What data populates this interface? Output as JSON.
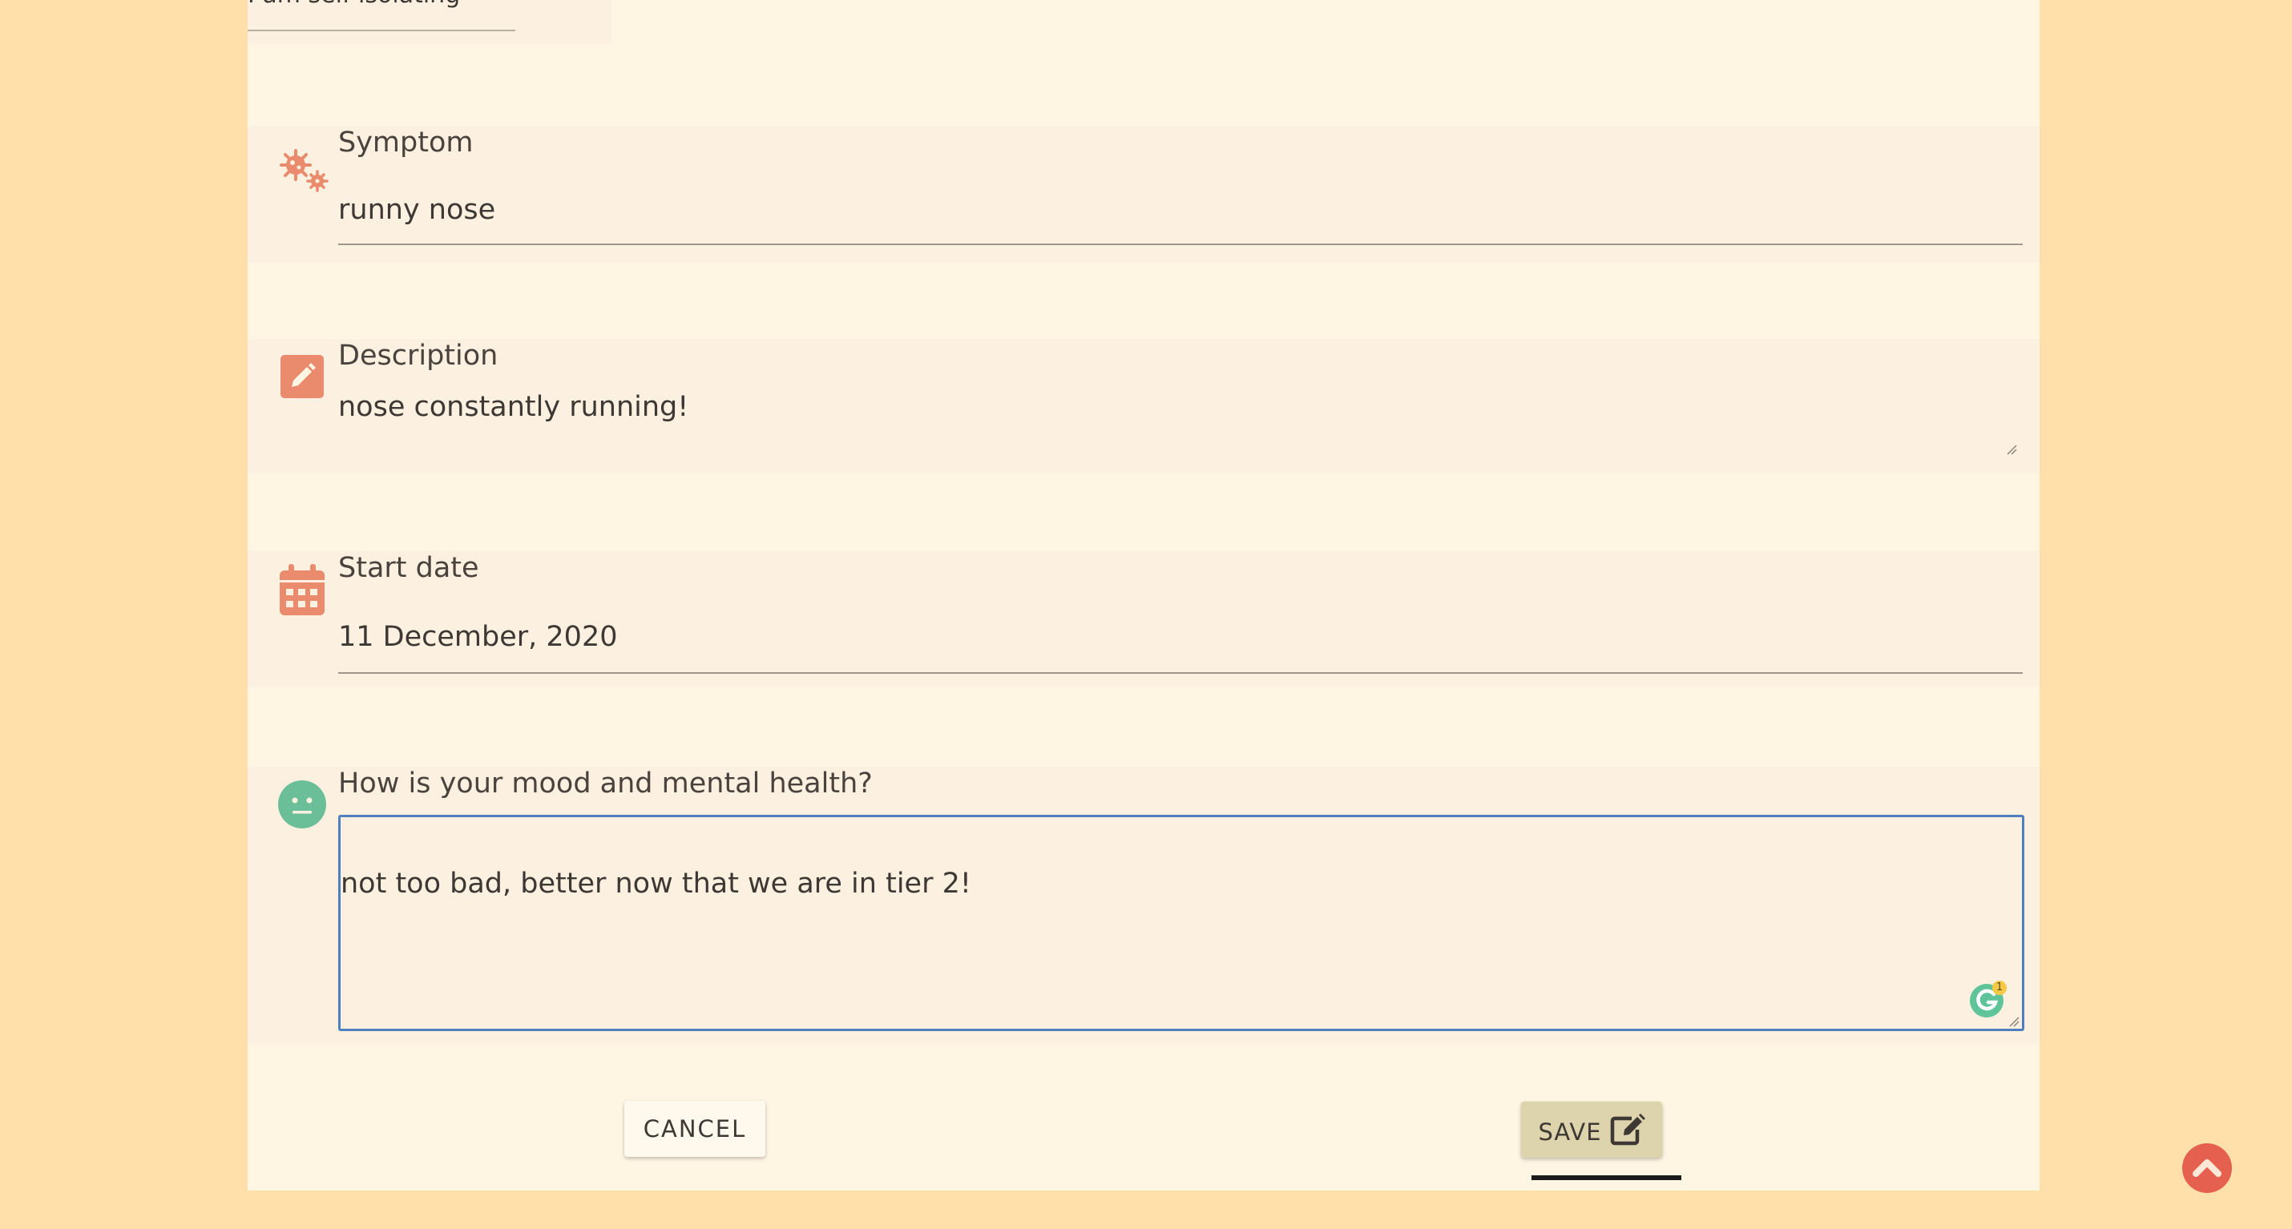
{
  "top_field": {
    "value": "I am self isolating"
  },
  "form": {
    "symptom": {
      "label": "Symptom",
      "value": "runny nose",
      "icon": "virus-icon"
    },
    "description": {
      "label": "Description",
      "value": "nose constantly running!",
      "icon": "pencil-square-icon"
    },
    "start_date": {
      "label": "Start date",
      "value": "11 December, 2020",
      "icon": "calendar-icon"
    },
    "mood": {
      "label": "How is your mood and mental health?",
      "value": "not too bad, better now that we are in tier 2!",
      "icon": "neutral-face-icon"
    }
  },
  "actions": {
    "cancel_label": "CANCEL",
    "save_label": "SAVE",
    "save_icon": "edit-icon",
    "scroll_top_icon": "chevron-up-icon"
  },
  "grammarly": {
    "badge_count": "1"
  },
  "colors": {
    "page_bg": "#ffe0aa",
    "card_bg": "#fff5e3",
    "field_bg": "#fcf1e0",
    "icon_orange": "#ea8b6e",
    "mood_green": "#6abf98",
    "focus_border": "#4f7fbd",
    "save_bg": "#ddd3ac",
    "scroll_btn": "#e5604f"
  }
}
